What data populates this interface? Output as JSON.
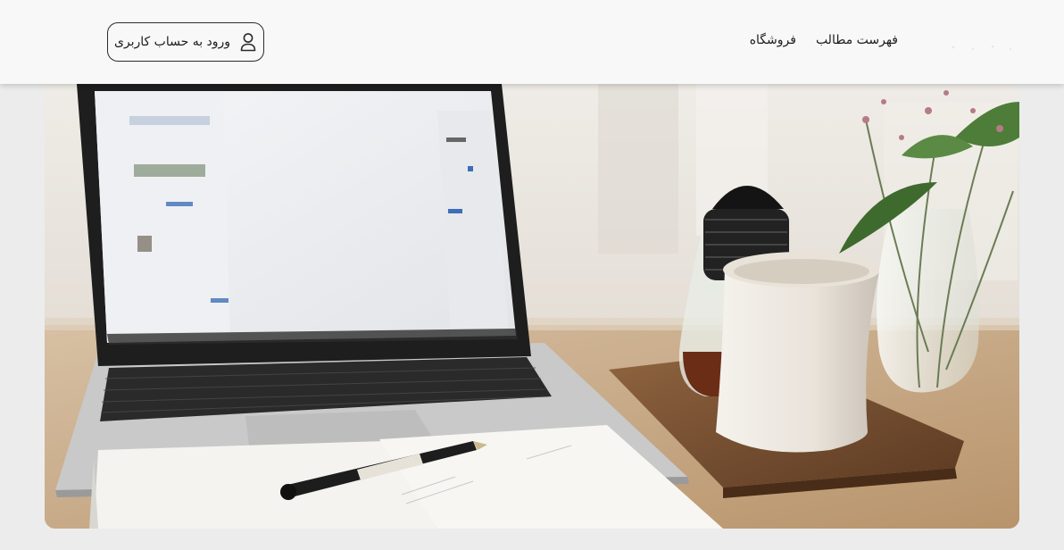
{
  "header": {
    "nav": [
      {
        "label": "فهرست مطالب"
      },
      {
        "label": "فروشگاه"
      }
    ],
    "login_label": "ورود به حساب کاربری"
  },
  "hero": {
    "colors": {
      "background": "#ece8e2",
      "table": "#c9ab88",
      "laptop_body": "#cfcfcf",
      "laptop_bezel": "#1e1e1e",
      "mug": "#ebe6df",
      "tray": "#7a5234"
    }
  }
}
